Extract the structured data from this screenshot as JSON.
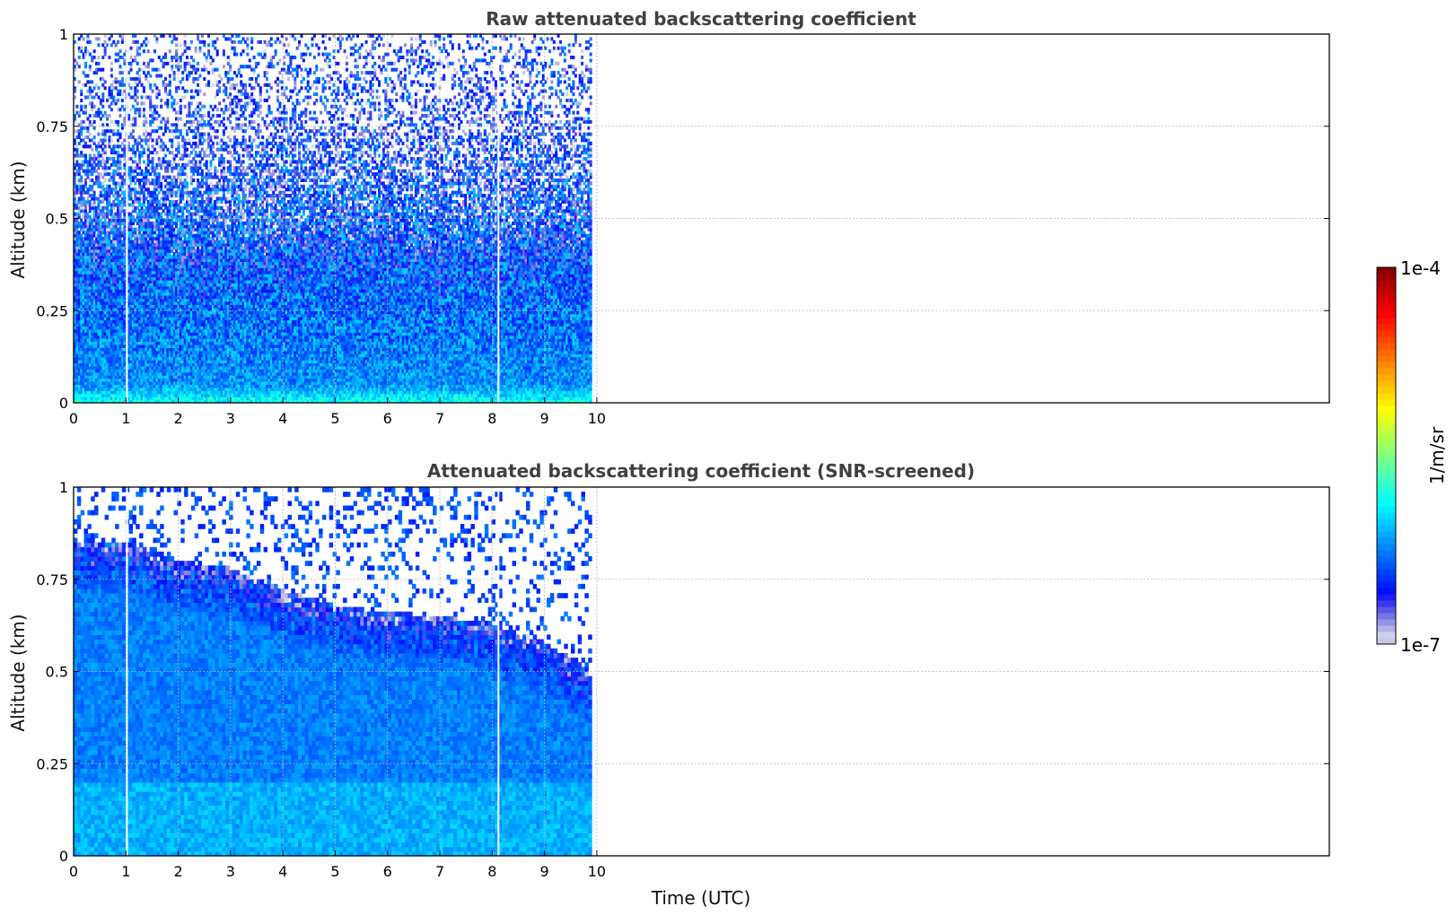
{
  "figure": {
    "xlabel": "Time (UTC)",
    "colorbar": {
      "label": "1/m/sr",
      "max_label": "1e-4",
      "min_label": "1e-7",
      "colormap": "jet (white at minimum)",
      "scale": "log"
    }
  },
  "chart_data": [
    {
      "type": "heatmap",
      "title": "Raw attenuated backscattering coefficient",
      "ylabel": "Altitude (km)",
      "xlim": [
        0,
        24
      ],
      "ylim": [
        0,
        1
      ],
      "x_ticks": [
        "0",
        "1",
        "2",
        "3",
        "4",
        "5",
        "6",
        "7",
        "8",
        "9",
        "10"
      ],
      "y_ticks": [
        "0",
        "0.25",
        "0.5",
        "0.75",
        "1"
      ],
      "grid": true,
      "data_time_range": [
        0,
        9.9
      ],
      "gap_times": [
        1.02,
        8.12
      ],
      "color_scale": [
        1e-07,
        0.0001
      ],
      "description_value_profile": {
        "altitudes": [
          0,
          0.05,
          0.25,
          0.5,
          0.75,
          1
        ],
        "log10_values": [
          -5.8,
          -6.2,
          -6.3,
          -6.5,
          -6.8,
          -7.0
        ]
      },
      "noise": "high"
    },
    {
      "type": "heatmap",
      "title": "Attenuated backscattering coefficient (SNR-screened)",
      "ylabel": "Altitude (km)",
      "xlim": [
        0,
        24
      ],
      "ylim": [
        0,
        1
      ],
      "x_ticks": [
        "0",
        "1",
        "2",
        "3",
        "4",
        "5",
        "6",
        "7",
        "8",
        "9",
        "10"
      ],
      "y_ticks": [
        "0",
        "0.25",
        "0.5",
        "0.75",
        "1"
      ],
      "grid": true,
      "data_time_range": [
        0,
        9.9
      ],
      "gap_times": [
        1.02,
        8.12
      ],
      "color_scale": [
        1e-07,
        0.0001
      ],
      "layer_top_km": {
        "times": [
          0,
          1,
          2,
          3,
          4,
          5,
          6,
          7,
          8,
          9,
          9.9
        ],
        "heights": [
          0.85,
          0.85,
          0.8,
          0.78,
          0.72,
          0.68,
          0.66,
          0.65,
          0.63,
          0.58,
          0.5
        ]
      },
      "noise": "low"
    }
  ]
}
